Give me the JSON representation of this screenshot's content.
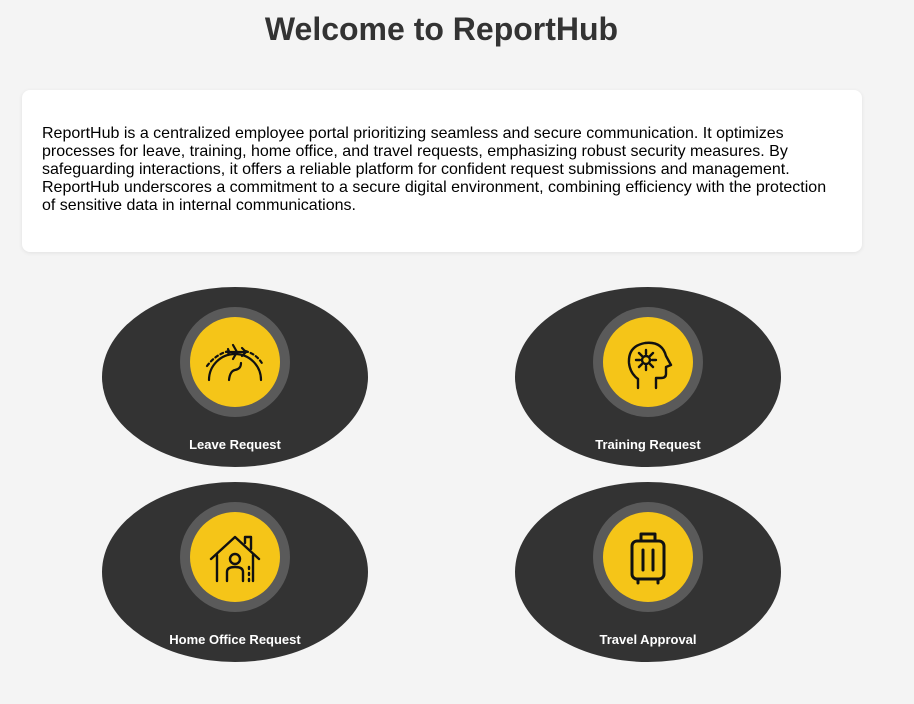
{
  "header": {
    "title": "Welcome to ReportHub"
  },
  "intro": {
    "text": "ReportHub is a centralized employee portal prioritizing seamless and secure communication. It optimizes processes for leave, training, home office, and travel requests, emphasizing robust security measures. By safeguarding interactions, it offers a reliable platform for confident request submissions and management. ReportHub underscores a commitment to a secure digital environment, combining efficiency with the protection of sensitive data in internal communications."
  },
  "tiles": [
    {
      "label": "Leave Request",
      "icon": "airplane-globe-icon"
    },
    {
      "label": "Training Request",
      "icon": "head-gear-icon"
    },
    {
      "label": "Home Office Request",
      "icon": "house-person-icon"
    },
    {
      "label": "Travel Approval",
      "icon": "luggage-icon"
    }
  ],
  "colors": {
    "background": "#f4f4f4",
    "tile": "#333333",
    "ring": "#5a5a5a",
    "accent": "#f5c518",
    "title": "#333333"
  }
}
